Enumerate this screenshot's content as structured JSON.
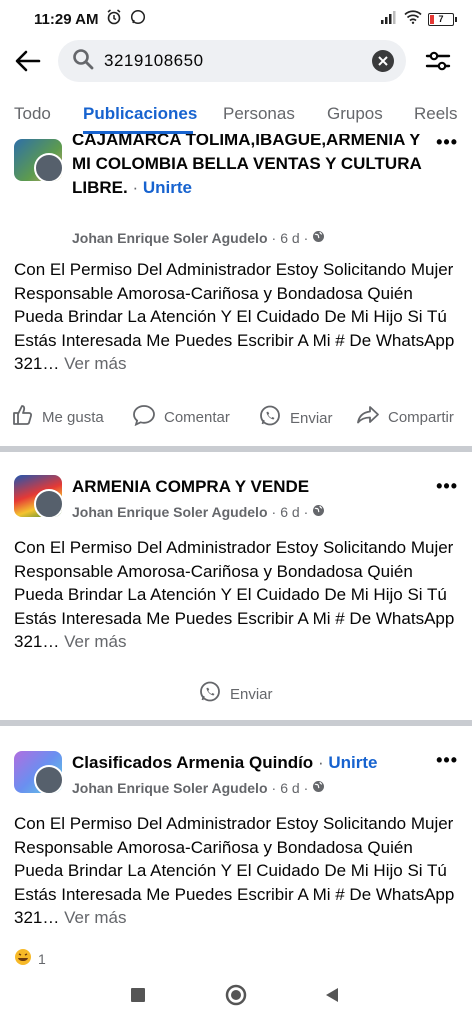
{
  "status": {
    "time": "11:29 AM",
    "battery": "7"
  },
  "search": {
    "query": "3219108650"
  },
  "tabs": [
    "Todo",
    "Publicaciones",
    "Personas",
    "Grupos",
    "Reels"
  ],
  "posts": [
    {
      "group_name": "CAJAMARCA TOLIMA,IBAGUE,ARMENIA Y MI COLOMBIA BELLA VENTAS Y CULTURA LIBRE.",
      "join": "Unirte",
      "author": "Johan Enrique Soler Agudelo",
      "time": "6 d",
      "text": "Con El Permiso Del Administrador Estoy Solicitando Mujer Responsable Amorosa-Cariñosa y Bondadosa Quién Pueda Brindar La Atención Y El Cuidado De Mi Hijo Si Tú Estás Interesada Me Puedes Escribir A Mi # De WhatsApp 321…",
      "see_more": "Ver más",
      "actions": {
        "like": "Me gusta",
        "comment": "Comentar",
        "send": "Enviar",
        "share": "Compartir"
      }
    },
    {
      "group_name": "ARMENIA COMPRA Y VENDE",
      "author": "Johan Enrique Soler Agudelo",
      "time": "6 d",
      "text": "Con El Permiso Del Administrador Estoy Solicitando Mujer Responsable Amorosa-Cariñosa y Bondadosa Quién Pueda Brindar La Atención Y El Cuidado De Mi Hijo Si Tú Estás Interesada Me Puedes Escribir A Mi # De WhatsApp 321…",
      "see_more": "Ver más",
      "actions": {
        "send": "Enviar"
      }
    },
    {
      "group_name": "Clasificados Armenia Quindío",
      "join": "Unirte",
      "author": "Johan Enrique Soler Agudelo",
      "time": "6 d",
      "text": "Con El Permiso Del Administrador Estoy Solicitando Mujer Responsable Amorosa-Cariñosa y Bondadosa Quién Pueda Brindar La Atención Y El Cuidado De Mi Hijo Si Tú Estás Interesada Me Puedes Escribir A Mi # De WhatsApp 321…",
      "see_more": "Ver más",
      "reaction_count": "1"
    }
  ],
  "sep": "·",
  "more": "•••",
  "colors": {
    "accent": "#1763cf",
    "muted": "#65676b"
  }
}
